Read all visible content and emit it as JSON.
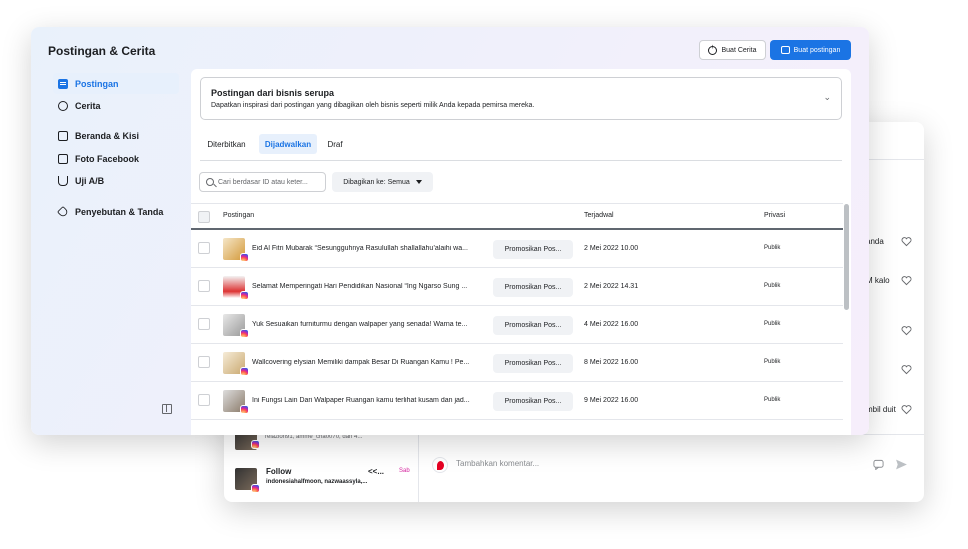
{
  "back_window": {
    "right_snippets": [
      "anda",
      "M kalo",
      "mbil duit"
    ],
    "bottom_small_text": "relazion91, amme_cha0070, dan 4...",
    "follow_label": "Follow",
    "follow_arrows": "<<...",
    "sab_label": "Sab",
    "follow_names": "indonesiahalfmoon, nazwaassyla,...",
    "comment_placeholder": "Tambahkan komentar..."
  },
  "header": {
    "title": "Postingan & Cerita",
    "create_story_label": "Buat Cerita",
    "create_post_label": "Buat postingan"
  },
  "sidebar": {
    "items": [
      {
        "label": "Postingan",
        "icon": "posts-icon",
        "active": true
      },
      {
        "label": "Cerita",
        "icon": "stories-icon",
        "active": false
      },
      {
        "label": "Beranda & Kisi",
        "icon": "grid-icon",
        "active": false
      },
      {
        "label": "Foto Facebook",
        "icon": "photo-icon",
        "active": false
      },
      {
        "label": "Uji A/B",
        "icon": "flask-icon",
        "active": false
      },
      {
        "label": "Penyebutan & Tanda",
        "icon": "tag-icon",
        "active": false
      }
    ]
  },
  "inspiration": {
    "title": "Postingan dari bisnis serupa",
    "subtitle": "Dapatkan inspirasi dari postingan yang dibagikan oleh bisnis seperti milik Anda kepada pemirsa mereka."
  },
  "tabs": [
    {
      "label": "Diterbitkan",
      "active": false
    },
    {
      "label": "Dijadwalkan",
      "active": true
    },
    {
      "label": "Draf",
      "active": false
    }
  ],
  "search": {
    "placeholder": "Cari berdasar ID atau keter..."
  },
  "filter": {
    "label": "Dibagikan ke: Semua"
  },
  "table": {
    "headers": {
      "post": "Postingan",
      "scheduled": "Terjadwal",
      "privacy": "Privasi"
    },
    "rows": [
      {
        "text": "Eid Al Fitri Mubarak “Sesungguhnya Rasulullah shallallahu’alaihi wa...",
        "promo": "Promosikan Pos...",
        "date": "2 Mei 2022 10.00",
        "privacy": "Publik"
      },
      {
        "text": "Selamat Memperingati Hari Pendidikan Nasional “Ing Ngarso Sung ...",
        "promo": "Promosikan Pos...",
        "date": "2 Mei 2022 14.31",
        "privacy": "Publik"
      },
      {
        "text": "Yuk Sesuaikan furniturmu dengan walpaper yang senada! Warna te...",
        "promo": "Promosikan Pos...",
        "date": "4 Mei 2022 16.00",
        "privacy": "Publik"
      },
      {
        "text": "Wallcovering elysian Memiliki dampak Besar Di Ruangan Kamu ! Pe...",
        "promo": "Promosikan Pos...",
        "date": "8 Mei 2022 16.00",
        "privacy": "Publik"
      },
      {
        "text": "Ini Fungsi Lain Dari Walpaper Ruangan kamu terlihat kusam dan jad...",
        "promo": "Promosikan Pos...",
        "date": "9 Mei 2022 16.00",
        "privacy": "Publik"
      }
    ]
  },
  "colors": {
    "accent": "#1b74e4",
    "active_bg": "#e7f0fc"
  }
}
